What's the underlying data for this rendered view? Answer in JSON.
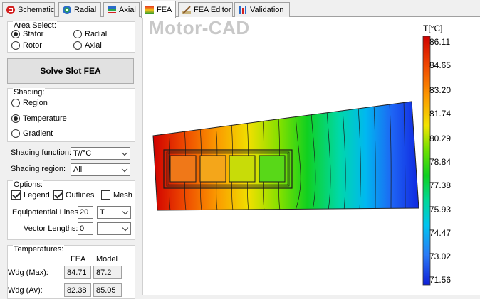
{
  "tabs": [
    {
      "label": "Schematic",
      "icon": "schematic-icon"
    },
    {
      "label": "Radial",
      "icon": "radial-icon"
    },
    {
      "label": "Axial",
      "icon": "axial-icon"
    },
    {
      "label": "FEA",
      "icon": "fea-icon",
      "active": true
    },
    {
      "label": "FEA Editor",
      "icon": "fea-editor-icon"
    },
    {
      "label": "Validation",
      "icon": "validation-icon"
    }
  ],
  "area_select": {
    "title": "Area Select:",
    "options": [
      "Stator",
      "Radial",
      "Rotor",
      "Axial"
    ],
    "selected": "Stator"
  },
  "solve_button": "Solve Slot FEA",
  "shading": {
    "title": "Shading:",
    "options": [
      "Region",
      "Temperature",
      "Gradient"
    ],
    "selected": "Temperature"
  },
  "shading_function": {
    "label": "Shading function:",
    "value": "T//°C"
  },
  "shading_region": {
    "label": "Shading region:",
    "value": "All"
  },
  "options": {
    "title": "Options:",
    "legend": {
      "label": "Legend",
      "checked": true
    },
    "outlines": {
      "label": "Outlines",
      "checked": true
    },
    "mesh": {
      "label": "Mesh",
      "checked": false
    },
    "equipotential": {
      "label": "Equipotential Lines:",
      "value": "20",
      "type": "T"
    },
    "vector": {
      "label": "Vector Lengths:",
      "value": "0",
      "type": ""
    }
  },
  "temperatures": {
    "title": "Temperatures:",
    "col_fea": "FEA",
    "col_model": "Model",
    "rows": [
      {
        "label": "Wdg (Max):",
        "fea": "84.71",
        "model": "87.2"
      },
      {
        "label": "Wdg (Av):",
        "fea": "82.38",
        "model": "85.05"
      }
    ]
  },
  "watermark": "Motor-CAD",
  "legend": {
    "title": "T[°C]",
    "ticks": [
      "86.11",
      "84.65",
      "83.20",
      "81.74",
      "80.29",
      "78.84",
      "77.38",
      "75.93",
      "74.47",
      "73.02",
      "71.56"
    ]
  }
}
